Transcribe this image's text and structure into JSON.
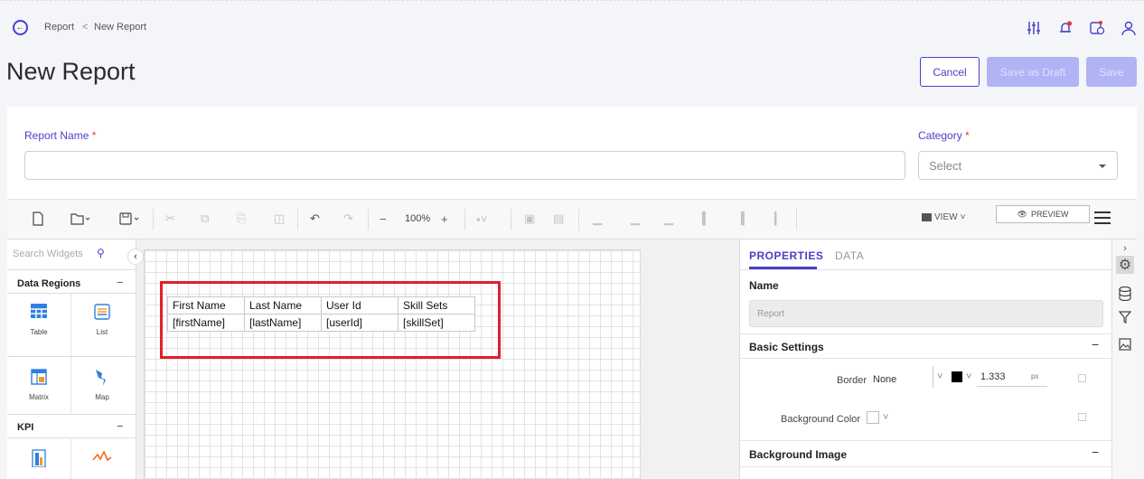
{
  "breadcrumb": {
    "root": "Report",
    "separator": "<",
    "current": "New Report"
  },
  "page_title": "New Report",
  "header_buttons": {
    "cancel": "Cancel",
    "save_draft": "Save as Draft",
    "save": "Save"
  },
  "form": {
    "report_name_label": "Report Name",
    "category_label": "Category",
    "required_marker": "*",
    "category_value": "Select",
    "report_name_value": ""
  },
  "toolbar": {
    "zoom": "100%",
    "view_label": "VIEW",
    "preview_label": "PREVIEW"
  },
  "widgets": {
    "search_placeholder": "Search Widgets",
    "sections": [
      {
        "title": "Data Regions",
        "toggle": "−",
        "items": [
          "Table",
          "List",
          "Matrix",
          "Map"
        ]
      },
      {
        "title": "KPI",
        "toggle": "−",
        "items": []
      }
    ]
  },
  "report_table": {
    "headers": [
      "First Name",
      "Last Name",
      "User Id",
      "Skill Sets"
    ],
    "row": [
      "[firstName]",
      "[lastName]",
      "[userId]",
      "[skillSet]"
    ]
  },
  "properties": {
    "tabs": [
      "PROPERTIES",
      "DATA"
    ],
    "name_label": "Name",
    "name_value": "Report",
    "basic_settings": "Basic Settings",
    "collapse_symbol": "−",
    "border_label": "Border",
    "border_style": "None",
    "border_width": "1.333",
    "border_unit": "px",
    "background_color_label": "Background Color",
    "background_image": "Background Image"
  },
  "colors": {
    "accent": "#4a3fc9",
    "highlight": "#e0202a",
    "disabled_button": "#b1b3f5"
  },
  "icons": [
    "back-arrow-icon",
    "filter-sliders-icon",
    "bell-icon",
    "report-icon",
    "user-icon",
    "gear-icon",
    "database-icon",
    "funnel-icon",
    "image-icon"
  ]
}
